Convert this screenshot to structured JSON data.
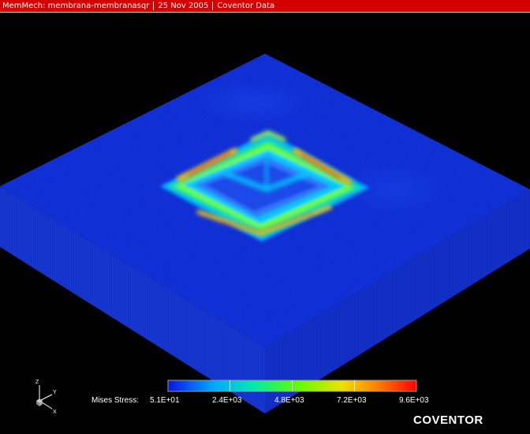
{
  "titlebar": {
    "app": "MemMech: membrana-membranasqr",
    "date": "25 Nov 2005",
    "source": "Coventor Data"
  },
  "legend": {
    "label": "Mises Stress:",
    "ticks": [
      "5.1E+01",
      "2.4E+03",
      "4.8E+03",
      "7.2E+03",
      "9.6E+03"
    ],
    "colors": [
      "#0a14e6",
      "#00a6ff",
      "#00e8b0",
      "#5cff00",
      "#f0e000",
      "#ff7a00",
      "#ff0000"
    ]
  },
  "axes": {
    "z": "Z",
    "y": "Y",
    "x": "X"
  },
  "brand": "COVENTOR",
  "colors": {
    "titlebar": "#d40000",
    "background": "#000000",
    "plate": "#1030d8"
  }
}
